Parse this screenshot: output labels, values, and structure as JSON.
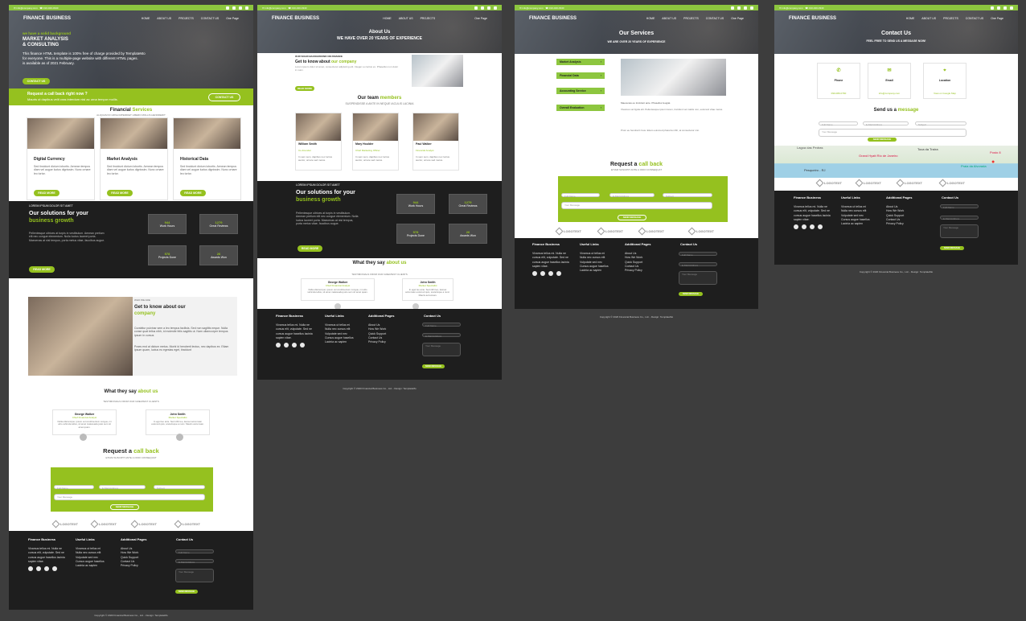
{
  "brand": "FINANCE BUSINESS",
  "topbar": {
    "email": "info@company.com",
    "phone": "010-020-0340"
  },
  "nav": {
    "home": "HOME",
    "about": "ABOUT US",
    "projects": "PROJECTS",
    "contact": "CONTACT US",
    "one_page": "One Page"
  },
  "home": {
    "hero_tag": "we have a solid background",
    "hero_title1": "MARKET ANALYSIS",
    "hero_title2": "& CONSULTING",
    "hero_text1": "This finance HTML template is 100% free of charge provided by TemplateMo",
    "hero_text2": "for everyone. This is a multiple-page website with different HTML pages.",
    "hero_text3": "is available as of 2021 February.",
    "hero_btn": "CONTACT US",
    "callback_title": "Request a call back right now ?",
    "callback_text": "Mauris ut dapibus velit cras interdum nisl ac urna tempor mollis.",
    "callback_btn": "CONTACT US",
    "services_title": "Financial",
    "services_accent": "Services",
    "services_sub": "ALIQUAM ID URNA IMPERDIET LIBERO MOLLIS HENDRERIT",
    "services": [
      {
        "title": "Digital Currency",
        "text": "Sed tincidunt dictum lobortis. Aenean tempus diam vel augue luctus dignissim. Nunc ornare leo tortor.",
        "btn": "READ MORE"
      },
      {
        "title": "Market Analysis",
        "text": "Sed tincidunt dictum lobortis. Aenean tempus diam vel augue luctus dignissim. Nunc ornare leo tortor.",
        "btn": "READ MORE"
      },
      {
        "title": "Historical Data",
        "text": "Sed tincidunt dictum lobortis. Aenean tempus diam vel augue luctus dignissim. Nunc ornare leo tortor.",
        "btn": "READ MORE"
      }
    ],
    "solutions_tag": "LOREM IPSUM DOLOR SIT AMET",
    "solutions_title": "Our solutions for your",
    "solutions_accent": "business growth",
    "solutions_text": "Pellentesque ultrices at turpis in vestibulum. Aenean pretium elit nec congue elementum. Nulla luctus laoreet porta. Maecenas at nisl tempus, porta metus vitae, faucibus augue.",
    "solutions_btn": "READ MORE",
    "stats": [
      {
        "n": "944",
        "l": "Work Hours"
      },
      {
        "n": "1279",
        "l": "Great Reviews"
      },
      {
        "n": "578",
        "l": "Projects Done"
      },
      {
        "n": "26",
        "l": "Awards Won"
      }
    ],
    "about_tag": "WHO WE ARE",
    "about_title": "Get to know about our",
    "about_accent": "company",
    "about_text1": "Curabitur pulvinar sem a leo tempus facilisis. Sed non sagittis neque. Nulla conse quat tellus nibh, id molestie felis sagittis ut. Nam ullamcorper tempus ipsum in cursus",
    "about_text2": "Praes end at dictum metus. Morbi id hendrerit lectus, nec dapibus ex. Etiam ipsum quam, luctus eu egestas eget, tincidunt",
    "testi_title": "What they say",
    "testi_accent": "about us",
    "testi_sub": "TESTIMONIALS FROM OUR GREATEST CLIENTS",
    "testimonials": [
      {
        "name": "George Walker",
        "role": "Chief Financial Analyst",
        "text": "Nulla ullamcorper, ipsum vel condimentum congue, mi odio vehicula tellus, sit amet malesuada justo sem sit amet quam."
      },
      {
        "name": "John Smith",
        "role": "Market Specialist",
        "text": "In eget leo ante. Sed nibh leo, laoreet accumsan euismod quis, scelerisque a nunc. Mauris accumsan."
      }
    ],
    "request_title": "Request a",
    "request_accent": "call back",
    "request_sub": "ETIAM SUSCIPIT ANTE A ODIO CONSEQUAT",
    "form": {
      "name": "Full Name",
      "email": "E-Mail Address",
      "subject": "Subject",
      "message": "Your Message",
      "btn": "SEND MESSAGE"
    },
    "logos": [
      "LOGOTEXT",
      "LOGOTEXT",
      "LOGOTEXT",
      "LOGOTEXT"
    ]
  },
  "about": {
    "page_title": "About Us",
    "page_sub": "WE HAVE OVER 20 YEARS OF EXPERIENCE",
    "intro_tag": "OUR SOLID BACKGROUND ON FINANCE",
    "intro_title": "Get to know about",
    "intro_accent": "our company",
    "intro_text": "Lorem ipsum dolor sit amet, consectetur adipiscing elit. Integer eu luctus ex. Phasellus non dolor in nunc.",
    "intro_btn": "READ MORE",
    "team_title": "Our team",
    "team_accent": "members",
    "team_sub": "SUSPENDISSE A ANTE IN NEQUE IACULIS LACINIA",
    "team": [
      {
        "name": "William Smith",
        "role": "Co-Founder",
        "text": "In sem sem, dapibus nec luctus auctor, ornare sed metus."
      },
      {
        "name": "Mary Houlder",
        "role": "Chief Marketing Officer",
        "text": "In sem sem, dapibus nec luctus auctor, ornare sed metus."
      },
      {
        "name": "Paul Walker",
        "role": "Financial Analyst",
        "text": "In sem sem, dapibus nec luctus auctor, ornare sed metus."
      }
    ]
  },
  "services_page": {
    "page_title": "Our Services",
    "page_sub": "WE ARE OVER 20 YEARS OF EXPERIENCE",
    "tabs": [
      "Market Analysis",
      "Financial Data",
      "Accounting Service",
      "Overall Evaluation"
    ],
    "text1": "Maecenas eu tincidunt ante. Phasellus feugiat.",
    "text2": "Vivamus vel ligula elit. Pellentesque ipsum lorem, tincidunt vel mattis non, euismod vitae metus.",
    "text3": "Proin eu hendrerit risus. Etiam euismod pharetra nibh, at consectetur nisi."
  },
  "contact": {
    "page_title": "Contact Us",
    "page_sub": "FEEL FREE TO SEND US A MESSAGE NOW!",
    "boxes": [
      {
        "title": "Phone",
        "link": "090-080-0760"
      },
      {
        "title": "Email",
        "link": "info@company.com"
      },
      {
        "title": "Location",
        "link": "View on Google Map"
      }
    ],
    "send_title": "Send us a",
    "send_accent": "message",
    "map_labels": [
      "Lagoa das Pedras",
      "Grand Hyatt Rio de Janeiro",
      "Toca da Traíra",
      "Posto 8",
      "Praia da Alvorada",
      "Pesqueiro - RJ"
    ]
  },
  "footer": {
    "col1_title": "Finance Business",
    "col1_text": "Vivamus tellus mi. Nulla ne cursus elit, vulputate. Sed ne cursus augue hasellus lacinia sapien vitae.",
    "col2_title": "Useful Links",
    "col2_links": [
      "Vivamus ut tellus mi",
      "Nulla nec cursus elit",
      "Vulputate sed nec",
      "Cursus augue hasellus",
      "Lacinia ac sapien"
    ],
    "col3_title": "Additional Pages",
    "col3_links": [
      "About Us",
      "How We Work",
      "Quick Support",
      "Contact Us",
      "Privacy Policy"
    ],
    "col4_title": "Contact Us",
    "form": {
      "name": "Full Name",
      "email": "E-Mail Address",
      "message": "Your Message",
      "btn": "SEND MESSAGE"
    },
    "copyright": "Copyright © 2020 Financial Business Co., Ltd. - Design: TemplateMo"
  },
  "colors": {
    "accent": "#95c11f",
    "topbar": "#8dc63f",
    "footer": "#1e1e1e",
    "background": "#3d3d3d"
  }
}
